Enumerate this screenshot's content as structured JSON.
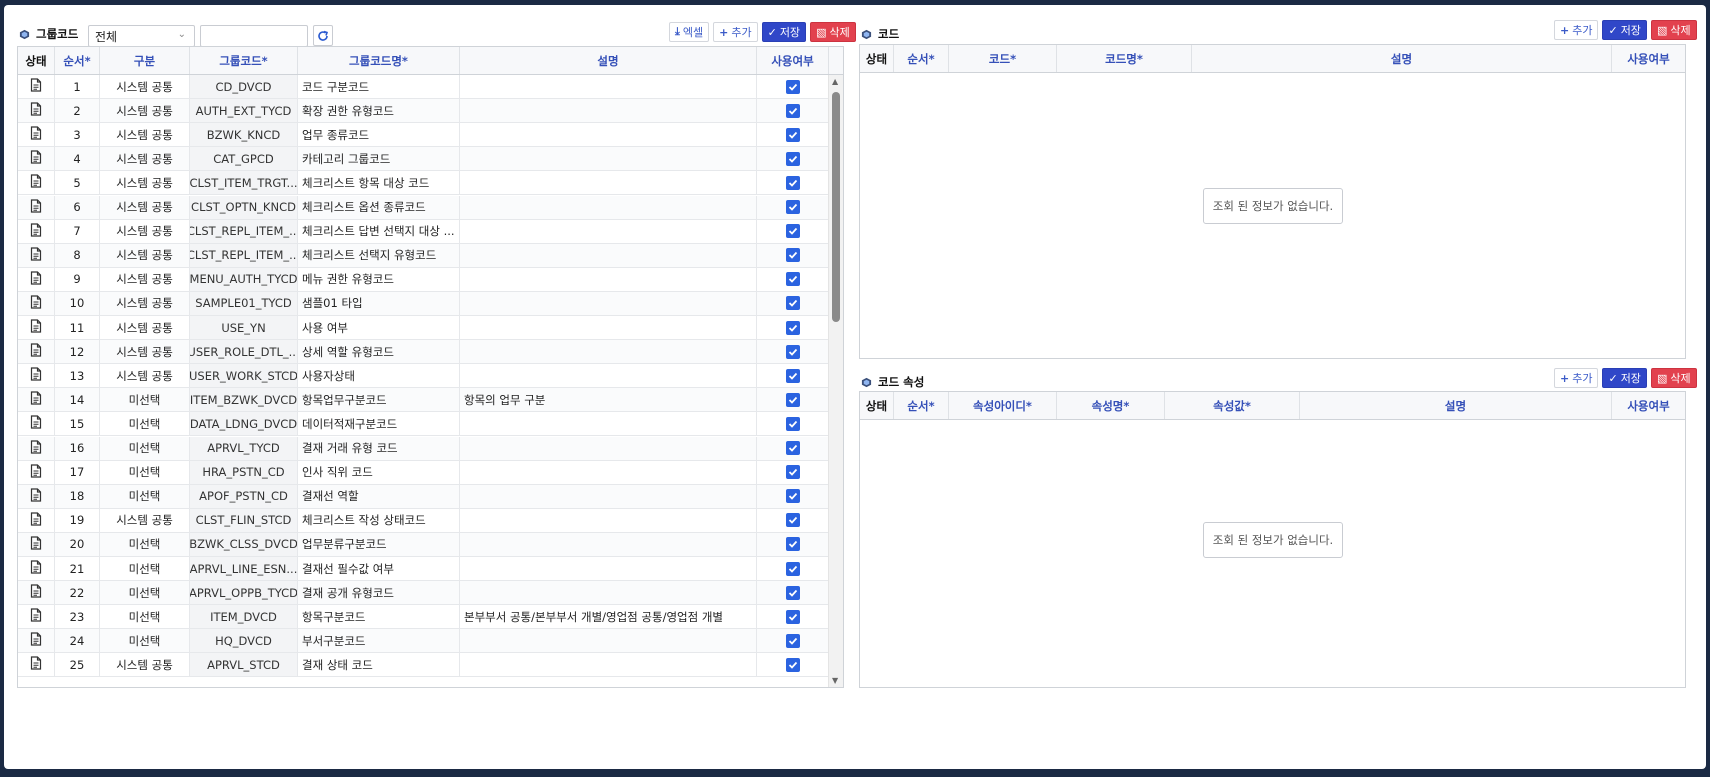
{
  "left": {
    "title": "그룹코드",
    "filter_value": "전체",
    "search_value": "",
    "buttons": {
      "excel": "엑셀",
      "add": "추가",
      "save": "저장",
      "delete": "삭제"
    },
    "columns": {
      "status": "상태",
      "order": "순서*",
      "category": "구분",
      "group_code": "그룹코드*",
      "group_name": "그룹코드명*",
      "desc": "설명",
      "use": "사용여부"
    },
    "rows": [
      {
        "no": "1",
        "cat": "시스템 공통",
        "code": "CD_DVCD",
        "name": "코드 구분코드",
        "desc": ""
      },
      {
        "no": "2",
        "cat": "시스템 공통",
        "code": "AUTH_EXT_TYCD",
        "name": "확장 권한 유형코드",
        "desc": ""
      },
      {
        "no": "3",
        "cat": "시스템 공통",
        "code": "BZWK_KNCD",
        "name": "업무 종류코드",
        "desc": ""
      },
      {
        "no": "4",
        "cat": "시스템 공통",
        "code": "CAT_GPCD",
        "name": "카테고리 그룹코드",
        "desc": ""
      },
      {
        "no": "5",
        "cat": "시스템 공통",
        "code": "CLST_ITEM_TRGT...",
        "name": "체크리스트 항목 대상 코드",
        "desc": ""
      },
      {
        "no": "6",
        "cat": "시스템 공통",
        "code": "CLST_OPTN_KNCD",
        "name": "체크리스트 옵션 종류코드",
        "desc": ""
      },
      {
        "no": "7",
        "cat": "시스템 공통",
        "code": "CLST_REPL_ITEM_...",
        "name": "체크리스트 답변 선택지 대상 ...",
        "desc": ""
      },
      {
        "no": "8",
        "cat": "시스템 공통",
        "code": "CLST_REPL_ITEM_...",
        "name": "체크리스트 선택지 유형코드",
        "desc": ""
      },
      {
        "no": "9",
        "cat": "시스템 공통",
        "code": "MENU_AUTH_TYCD",
        "name": "메뉴 권한 유형코드",
        "desc": ""
      },
      {
        "no": "10",
        "cat": "시스템 공통",
        "code": "SAMPLE01_TYCD",
        "name": "샘플01 타입",
        "desc": ""
      },
      {
        "no": "11",
        "cat": "시스템 공통",
        "code": "USE_YN",
        "name": "사용 여부",
        "desc": ""
      },
      {
        "no": "12",
        "cat": "시스템 공통",
        "code": "USER_ROLE_DTL_...",
        "name": "상세 역할 유형코드",
        "desc": ""
      },
      {
        "no": "13",
        "cat": "시스템 공통",
        "code": "USER_WORK_STCD",
        "name": "사용자상태",
        "desc": ""
      },
      {
        "no": "14",
        "cat": "미선택",
        "code": "ITEM_BZWK_DVCD",
        "name": "항목업무구분코드",
        "desc": "항목의 업무 구분"
      },
      {
        "no": "15",
        "cat": "미선택",
        "code": "DATA_LDNG_DVCD",
        "name": "데이터적재구분코드",
        "desc": ""
      },
      {
        "no": "16",
        "cat": "미선택",
        "code": "APRVL_TYCD",
        "name": "결재 거래 유형 코드",
        "desc": ""
      },
      {
        "no": "17",
        "cat": "미선택",
        "code": "HRA_PSTN_CD",
        "name": "인사 직위 코드",
        "desc": ""
      },
      {
        "no": "18",
        "cat": "미선택",
        "code": "APOF_PSTN_CD",
        "name": "결재선 역할",
        "desc": ""
      },
      {
        "no": "19",
        "cat": "시스템 공통",
        "code": "CLST_FLIN_STCD",
        "name": "체크리스트 작성 상태코드",
        "desc": ""
      },
      {
        "no": "20",
        "cat": "미선택",
        "code": "BZWK_CLSS_DVCD",
        "name": "업무분류구분코드",
        "desc": ""
      },
      {
        "no": "21",
        "cat": "미선택",
        "code": "APRVL_LINE_ESN...",
        "name": "결재선 필수값 여부",
        "desc": ""
      },
      {
        "no": "22",
        "cat": "미선택",
        "code": "APRVL_OPPB_TYCD",
        "name": "결재 공개 유형코드",
        "desc": ""
      },
      {
        "no": "23",
        "cat": "미선택",
        "code": "ITEM_DVCD",
        "name": "항목구분코드",
        "desc": "본부부서 공통/본부부서 개별/영업점 공통/영업점 개별"
      },
      {
        "no": "24",
        "cat": "미선택",
        "code": "HQ_DVCD",
        "name": "부서구분코드",
        "desc": ""
      },
      {
        "no": "25",
        "cat": "시스템 공통",
        "code": "APRVL_STCD",
        "name": "결재 상태 코드",
        "desc": ""
      }
    ]
  },
  "code": {
    "title": "코드",
    "buttons": {
      "add": "추가",
      "save": "저장",
      "delete": "삭제"
    },
    "columns": {
      "status": "상태",
      "order": "순서*",
      "code": "코드*",
      "name": "코드명*",
      "desc": "설명",
      "use": "사용여부"
    },
    "empty": "조회 된 정보가 없습니다."
  },
  "attr": {
    "title": "코드 속성",
    "buttons": {
      "add": "추가",
      "save": "저장",
      "delete": "삭제"
    },
    "columns": {
      "status": "상태",
      "order": "순서*",
      "attr_id": "속성아이디*",
      "attr_name": "속성명*",
      "attr_value": "속성값*",
      "desc": "설명",
      "use": "사용여부"
    },
    "empty": "조회 된 정보가 없습니다."
  }
}
